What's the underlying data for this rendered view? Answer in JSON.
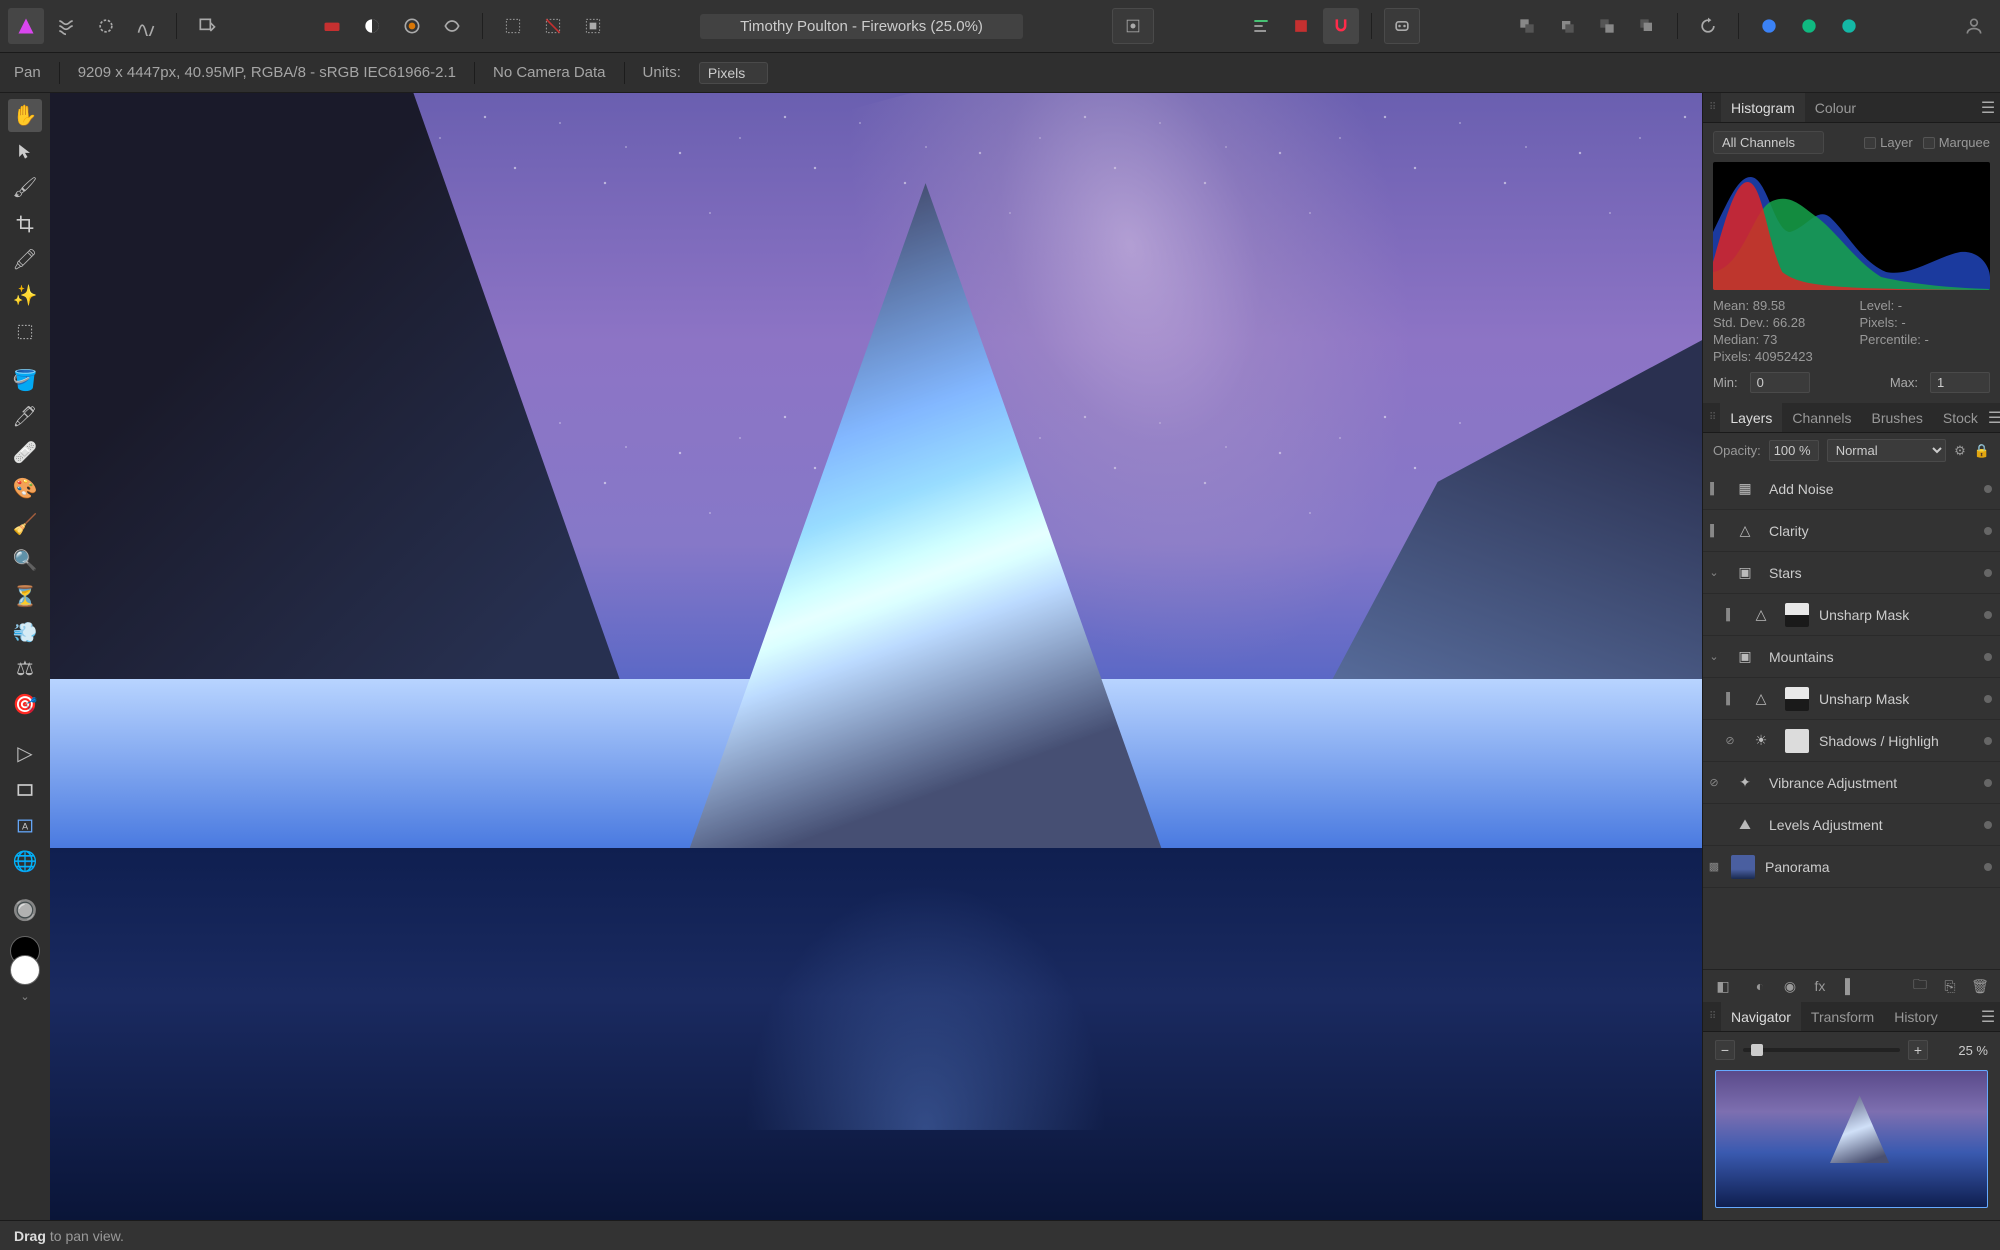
{
  "toolbar": {
    "document_title": "Timothy Poulton - Fireworks (25.0%)"
  },
  "context": {
    "tool": "Pan",
    "dims": "9209 x 4447px, 40.95MP, RGBA/8 - sRGB IEC61966-2.1",
    "camera": "No Camera Data",
    "units_label": "Units:",
    "units_value": "Pixels"
  },
  "histogram": {
    "tabs": {
      "active": "Histogram",
      "inactive": "Colour"
    },
    "channel": "All Channels",
    "layer_label": "Layer",
    "marquee_label": "Marquee",
    "stats": {
      "mean": "Mean: 89.58",
      "stddev": "Std. Dev.: 66.28",
      "median": "Median: 73",
      "pixels": "Pixels: 40952423",
      "level": "Level: -",
      "pixels2": "Pixels: -",
      "percentile": "Percentile: -"
    },
    "min_label": "Min:",
    "min_val": "0",
    "max_label": "Max:",
    "max_val": "1"
  },
  "layers_panel": {
    "tabs": {
      "t1": "Layers",
      "t2": "Channels",
      "t3": "Brushes",
      "t4": "Stock"
    },
    "opacity_label": "Opacity:",
    "opacity_val": "100 %",
    "blend": "Normal",
    "list": [
      {
        "name": "Add Noise"
      },
      {
        "name": "Clarity"
      },
      {
        "name": "Stars"
      },
      {
        "name": "Unsharp Mask"
      },
      {
        "name": "Mountains"
      },
      {
        "name": "Unsharp Mask"
      },
      {
        "name": "Shadows / Highligh"
      },
      {
        "name": "Vibrance Adjustment"
      },
      {
        "name": "Levels Adjustment"
      },
      {
        "name": "Panorama"
      }
    ]
  },
  "navigator": {
    "tabs": {
      "t1": "Navigator",
      "t2": "Transform",
      "t3": "History"
    },
    "zoom": "25 %"
  },
  "status": {
    "bold": "Drag",
    "rest": "to pan view."
  }
}
